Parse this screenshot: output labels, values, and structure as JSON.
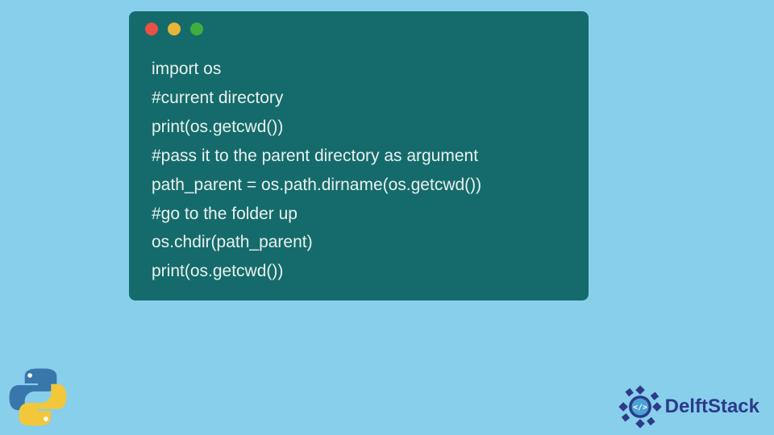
{
  "window": {
    "dots": {
      "red": "#e85143",
      "yellow": "#e8b437",
      "green": "#3fae3f"
    }
  },
  "code": {
    "lines": [
      "import os",
      "#current directory",
      "print(os.getcwd())",
      "#pass it to the parent directory as argument",
      "path_parent = os.path.dirname(os.getcwd())",
      "#go to the folder up",
      "os.chdir(path_parent)",
      "print(os.getcwd())"
    ]
  },
  "brand": {
    "name": "DelftStack"
  }
}
